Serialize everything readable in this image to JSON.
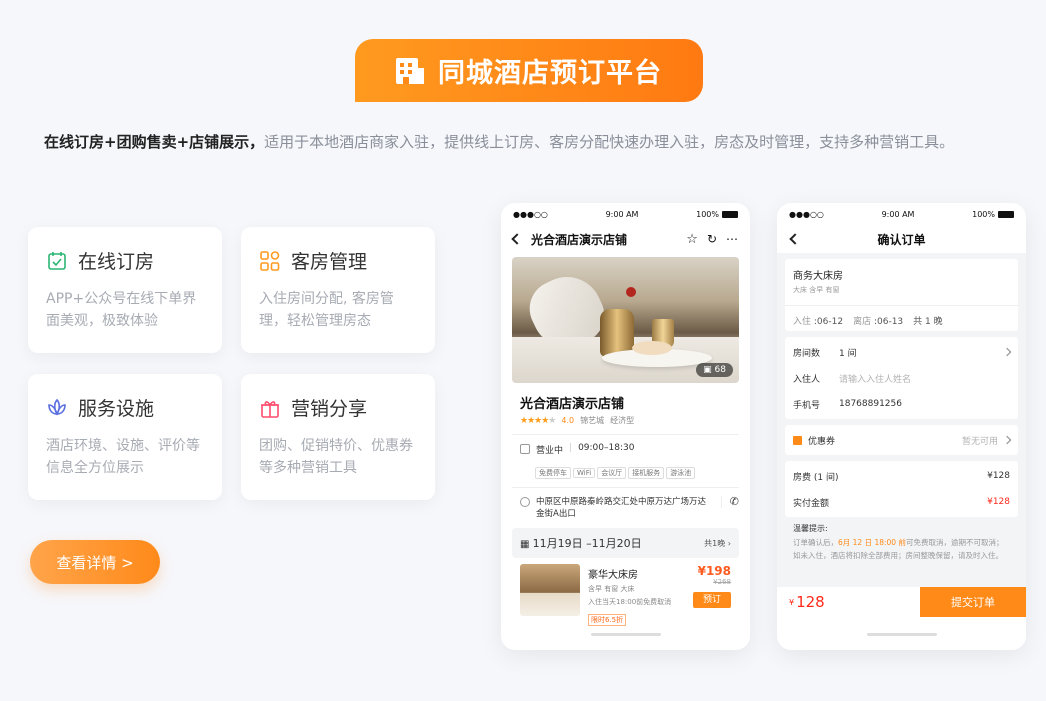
{
  "banner": {
    "title": "同城酒店预订平台",
    "icon": "building-icon"
  },
  "intro": {
    "strong": "在线订房+团购售卖+店铺展示，",
    "text": "适用于本地酒店商家入驻，提供线上订房、客房分配快速办理入驻，房态及时管理，支持多种营销工具。"
  },
  "features": [
    {
      "title": "在线订房",
      "desc": "APP+公众号在线下单界面美观，极致体验",
      "icon": "calendar-check-icon",
      "color": "#2bb673"
    },
    {
      "title": "客房管理",
      "desc": "入住房间分配, 客房管理，轻松管理房态",
      "icon": "grid-icon",
      "color": "#ff9a1f"
    },
    {
      "title": "服务设施",
      "desc": "酒店环境、设施、评价等信息全方位展示",
      "icon": "lotus-icon",
      "color": "#5b6fe0"
    },
    {
      "title": "营销分享",
      "desc": "团购、促销特价、优惠券等多种营销工具",
      "icon": "gift-icon",
      "color": "#ff4d6d"
    }
  ],
  "detail_button": "查看详情 >",
  "phone1": {
    "status": {
      "carrier": "●●●○○",
      "time": "9:00 AM",
      "battery": "100%"
    },
    "title": "光合酒店演示店铺",
    "photo_count": "68",
    "hotel_name": "光合酒店演示店铺",
    "stars": "★★★★",
    "star_off": "★",
    "rating": "4.0",
    "area": "锦艺城",
    "type": "经济型",
    "hours_label": "营业中",
    "hours": "09:00–18:30",
    "facilities": [
      "免费停车",
      "WiFi",
      "会议厅",
      "接机服务",
      "游泳池"
    ],
    "address": "中原区中原路秦岭路交汇处中原万达广场万达金街A出口",
    "dates": "11月19日 –11月20日",
    "nights": "共1晚",
    "room": {
      "name": "豪华大床房",
      "features": "含早   有窗   大床",
      "policy": "入住当天18:00前免费取消",
      "discount": "限时6.5折",
      "price": "¥198",
      "original_price": "¥268",
      "book": "预订"
    }
  },
  "phone2": {
    "status": {
      "carrier": "●●●○○",
      "time": "9:00 AM",
      "battery": "100%"
    },
    "title": "确认订单",
    "room_name": "商务大床房",
    "room_features": "大床   含早   有窗",
    "checkin_label": "入住",
    "checkin": "06-12",
    "checkout_label": "离店",
    "checkout": "06-13",
    "nights": "共 1 晚",
    "rooms_label": "房间数",
    "rooms": "1 间",
    "guest_label": "入住人",
    "guest_placeholder": "请输入入住人姓名",
    "phone_label": "手机号",
    "phone": "18768891256",
    "coupon_label": "优惠券",
    "coupon_status": "暂无可用",
    "fee_label": "房费 (1 间)",
    "fee": "¥128",
    "pay_label": "实付金额",
    "pay": "¥128",
    "tips_title": "温馨提示:",
    "tips_a": "订单确认后，",
    "tips_hl": "6月 12 日 18:00 前",
    "tips_b": "可免费取消，逾期不可取消；如未入住，酒店将扣除全部费用；房间整晚保留，请及时入住。",
    "total_symbol": "¥",
    "total": "128",
    "submit": "提交订单"
  }
}
